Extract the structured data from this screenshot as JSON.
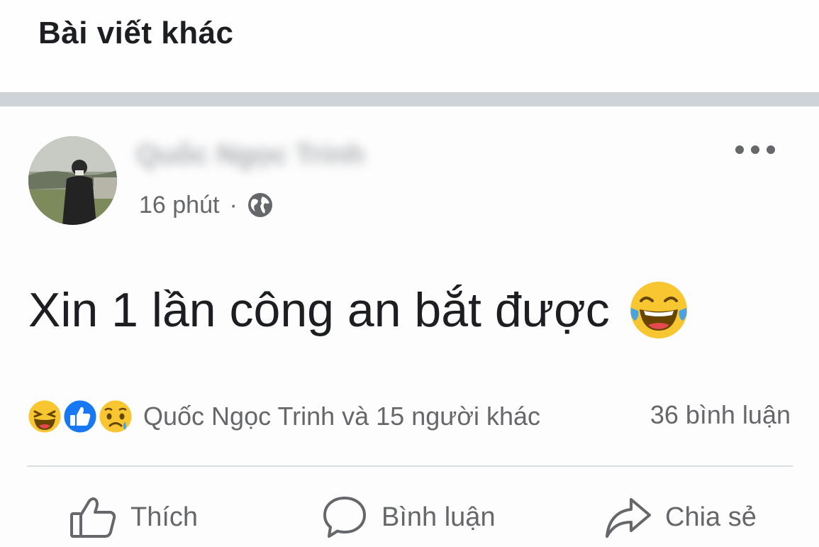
{
  "section": {
    "title": "Bài viết khác"
  },
  "post": {
    "author_name": "Quốc Ngọc Trinh",
    "time": "16 phút",
    "separator": "·",
    "privacy_icon": "globe-icon",
    "text": "Xin 1 lần công an bắt được",
    "text_emoji": "laugh-crying-emoji",
    "reaction_icons": [
      "haha-reaction-icon",
      "like-reaction-icon",
      "sad-reaction-icon"
    ],
    "reaction_summary": "Quốc Ngọc Trinh và 15 người khác",
    "comment_count": "36 bình luận",
    "actions": [
      {
        "label": "Thích",
        "icon": "thumbs-up-icon"
      },
      {
        "label": "Bình luận",
        "icon": "comment-icon"
      },
      {
        "label": "Chia sẻ",
        "icon": "share-icon"
      }
    ]
  },
  "colors": {
    "text_primary": "#1c1e21",
    "text_secondary": "#65676b",
    "separator": "#cfd2d6",
    "like_blue": "#1877f2",
    "emoji_yellow": "#f7c631"
  }
}
